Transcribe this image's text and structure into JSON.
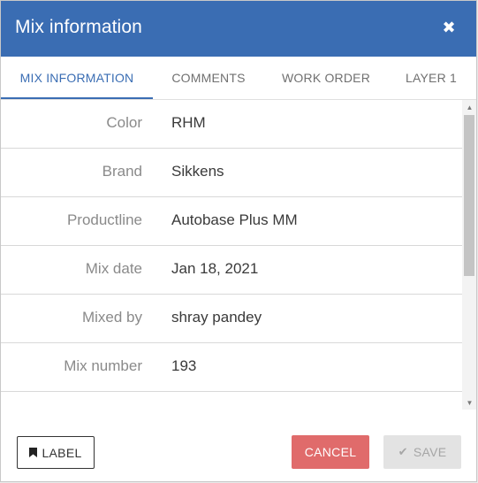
{
  "dialog": {
    "title": "Mix information",
    "close_glyph": "✖"
  },
  "tabs": [
    {
      "label": "MIX INFORMATION",
      "active": true
    },
    {
      "label": "COMMENTS",
      "active": false
    },
    {
      "label": "WORK ORDER",
      "active": false
    },
    {
      "label": "LAYER 1",
      "active": false
    }
  ],
  "rows": [
    {
      "label": "Color",
      "value": "RHM"
    },
    {
      "label": "Brand",
      "value": "Sikkens"
    },
    {
      "label": "Productline",
      "value": "Autobase Plus MM"
    },
    {
      "label": "Mix date",
      "value": "Jan 18, 2021"
    },
    {
      "label": "Mixed by",
      "value": "shray pandey"
    },
    {
      "label": "Mix number",
      "value": "193"
    }
  ],
  "footer": {
    "label_button": "LABEL",
    "cancel_button": "CANCEL",
    "save_button": "SAVE"
  },
  "colors": {
    "header": "#3a6db3",
    "accent": "#3a6db3",
    "cancel": "#e06b6b",
    "save_disabled": "#e3e3e3"
  },
  "icons": {
    "close": "close-icon",
    "label": "bookmark-icon",
    "save": "check-icon",
    "scroll_up": "scroll-up-arrow-icon",
    "scroll_down": "scroll-down-arrow-icon"
  }
}
